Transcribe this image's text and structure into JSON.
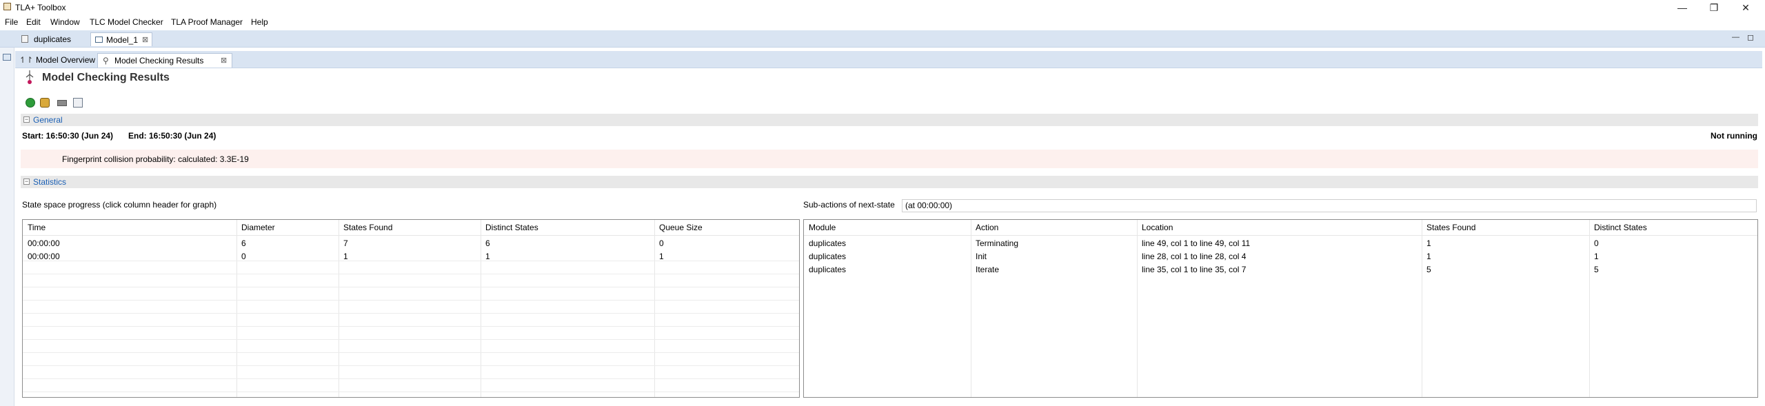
{
  "window": {
    "title": "TLA+ Toolbox",
    "controls": [
      "—",
      "❐",
      "✕"
    ]
  },
  "menu": [
    "File",
    "Edit",
    "Window",
    "TLC Model Checker",
    "TLA Proof Manager",
    "Help"
  ],
  "editor_tabs": [
    {
      "label": "duplicates",
      "active": false
    },
    {
      "label": "Model_1",
      "active": true
    }
  ],
  "page_tabs": [
    {
      "label": "Model Overview",
      "active": false
    },
    {
      "label": "Model Checking Results",
      "active": true
    }
  ],
  "page_title": "Model Checking Results",
  "general": {
    "title": "General",
    "start": "Start: 16:50:30 (Jun 24)",
    "end": "End: 16:50:30 (Jun 24)",
    "status": "Not running",
    "fingerprint": "Fingerprint collision probability: calculated: 3.3E-19"
  },
  "statistics": {
    "title": "Statistics",
    "progress_label": "State space progress (click column header for graph)",
    "subactions_label": "Sub-actions of next-state",
    "subactions_time": "(at 00:00:00)",
    "progress_table": {
      "columns": [
        "Time",
        "Diameter",
        "States Found",
        "Distinct States",
        "Queue Size"
      ],
      "rows": [
        [
          "00:00:00",
          "6",
          "7",
          "6",
          "0"
        ],
        [
          "00:00:00",
          "0",
          "1",
          "1",
          "1"
        ]
      ]
    },
    "actions_table": {
      "columns": [
        "Module",
        "Action",
        "Location",
        "States Found",
        "Distinct States"
      ],
      "rows": [
        [
          "duplicates",
          "Terminating",
          "line 49, col 1 to line 49, col 11",
          "1",
          "0"
        ],
        [
          "duplicates",
          "Init",
          "line 28, col 1 to line 28, col 4",
          "1",
          "1"
        ],
        [
          "duplicates",
          "Iterate",
          "line 35, col 1 to line 35, col 7",
          "5",
          "5"
        ]
      ]
    }
  }
}
